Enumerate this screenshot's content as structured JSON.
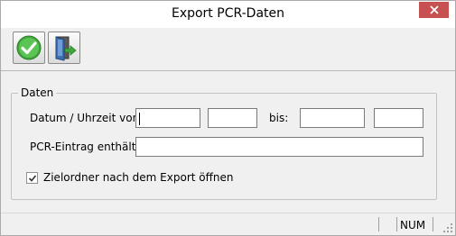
{
  "window": {
    "title": "Export PCR-Daten"
  },
  "toolbar": {
    "buttons": [
      {
        "name": "ok",
        "icon": "green-checkmark-icon"
      },
      {
        "name": "exit",
        "icon": "exit-door-icon"
      }
    ]
  },
  "group": {
    "label": "Daten"
  },
  "form": {
    "date_label": "Datum / Uhrzeit von:",
    "date_from": "",
    "time_from": "",
    "bis_label": "bis:",
    "date_to": "",
    "time_to": "",
    "pcr_label": "PCR-Eintrag enthält:",
    "pcr_value": "",
    "open_folder_label": "Zielordner nach dem Export öffnen",
    "open_folder_checked": true
  },
  "statusbar": {
    "num": "NUM"
  },
  "colors": {
    "close_button": "#c75050",
    "window_bg": "#f0f0f0",
    "ok_green": "#3fa83a"
  }
}
